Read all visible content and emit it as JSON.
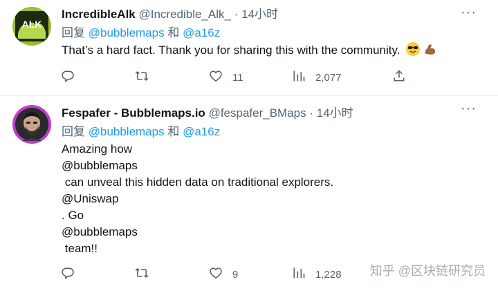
{
  "tweets": [
    {
      "display_name": "IncredibleAlk",
      "handle": "@Incredible_Alk_",
      "separator": "·",
      "time": "14小时",
      "reply_prefix": "回复",
      "reply_to_1": "@bubblemaps",
      "reply_and": "和",
      "reply_to_2": "@a16z",
      "text": "That’s a hard fact. Thank you for sharing this with the community.",
      "likes": "11",
      "views": "2,077"
    },
    {
      "display_name": "Fespafer - Bubblemaps.io",
      "handle": "@fespafer_BMaps",
      "separator": "·",
      "time": "14小时",
      "reply_prefix": "回复",
      "reply_to_1": "@bubblemaps",
      "reply_and": "和",
      "reply_to_2": "@a16z",
      "lines": [
        "Amazing how",
        "@bubblemaps",
        " can unveal this hidden data on traditional explorers.",
        "@Uniswap",
        ". Go",
        "@bubblemaps",
        " team!!"
      ],
      "likes": "9",
      "views": "1,228"
    }
  ],
  "icons": {
    "reply": "reply-icon",
    "retweet": "retweet-icon",
    "like": "heart-icon",
    "views": "views-icon",
    "share": "share-icon",
    "more": "more-icon"
  },
  "colors": {
    "accent": "#1d9bf0",
    "text": "#0f1419",
    "secondary": "#536471"
  },
  "watermark": "知乎 @区块链研究员"
}
